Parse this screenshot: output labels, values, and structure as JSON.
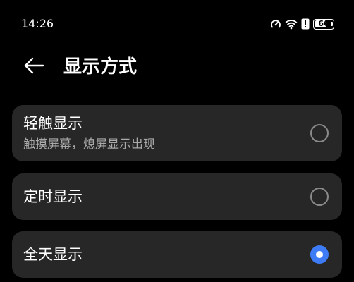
{
  "status_bar": {
    "time": "14:26",
    "battery_level": "66",
    "icons": [
      "speed-meter-icon",
      "wifi-icon",
      "alert-icon",
      "battery-icon"
    ]
  },
  "header": {
    "back_icon": "arrow-left-icon",
    "title": "显示方式"
  },
  "options": [
    {
      "label": "轻触显示",
      "description": "触摸屏幕，熄屏显示出现",
      "selected": false
    },
    {
      "label": "定时显示",
      "selected": false
    },
    {
      "label": "全天显示",
      "selected": true
    }
  ],
  "colors": {
    "background": "#000000",
    "card": "#272727",
    "accent": "#3d7bf7",
    "secondary_text": "#a9a9a9"
  }
}
